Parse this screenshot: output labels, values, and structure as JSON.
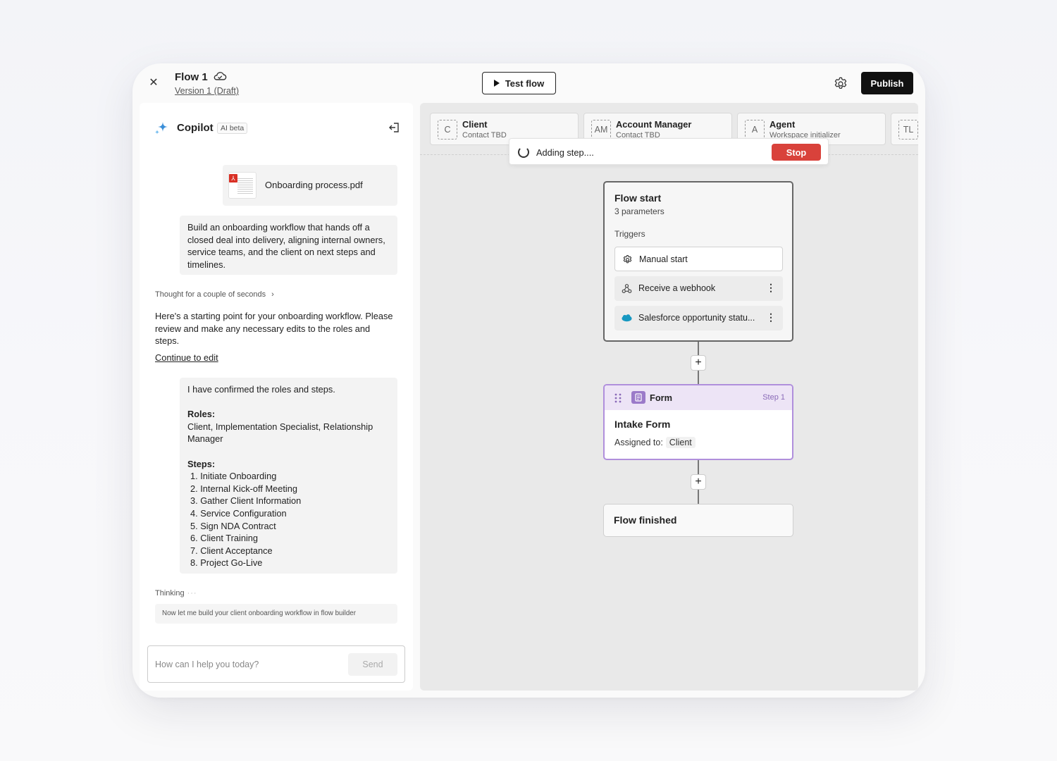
{
  "header": {
    "title": "Flow 1",
    "version": "Version 1 (Draft)",
    "test_label": "Test flow",
    "publish_label": "Publish"
  },
  "copilot": {
    "title": "Copilot",
    "badge": "AI beta",
    "attachment": "Onboarding process.pdf",
    "user_message_1": "Build an onboarding workflow that hands off a closed deal into delivery, aligning internal owners, service teams, and the client on next steps and timelines.",
    "thought": "Thought for a couple of seconds",
    "ai_message": "Here's a starting point for your onboarding workflow. Please review and make any necessary edits to the roles and steps.",
    "continue_link": "Continue to edit",
    "user_message_2": {
      "intro": "I have confirmed the roles and steps.",
      "roles_heading": "Roles:",
      "roles": "Client, Implementation Specialist, Relationship Manager",
      "steps_heading": "Steps:",
      "steps": [
        "1. Initiate Onboarding",
        "2. Internal Kick-off Meeting",
        "3. Gather Client Information",
        "4. Service Configuration",
        "5. Sign NDA Contract",
        "6. Client Training",
        "7. Client Acceptance",
        "8. Project Go-Live"
      ]
    },
    "thinking_label": "Thinking",
    "thinking_dots": "···",
    "thinking_text": "Now let me build your client onboarding workflow in flow builder",
    "input_placeholder": "How can I help you today?",
    "send_label": "Send"
  },
  "canvas": {
    "roles": [
      {
        "abbr": "C",
        "name": "Client",
        "sub": "Contact TBD"
      },
      {
        "abbr": "AM",
        "name": "Account Manager",
        "sub": "Contact TBD"
      },
      {
        "abbr": "A",
        "name": "Agent",
        "sub": "Workspace initializer"
      },
      {
        "abbr": "TL",
        "name": "",
        "sub": ""
      }
    ],
    "adding_text": "Adding step....",
    "stop_label": "Stop",
    "flow_start": {
      "title": "Flow start",
      "params": "3 parameters",
      "triggers_label": "Triggers",
      "triggers": [
        "Manual start",
        "Receive a webhook",
        "Salesforce opportunity statu..."
      ]
    },
    "form_node": {
      "type_label": "Form",
      "step_label": "Step 1",
      "title": "Intake Form",
      "assigned_label": "Assigned to:",
      "assignee": "Client"
    },
    "flow_end": {
      "title": "Flow finished"
    },
    "add_symbol": "+"
  },
  "colors": {
    "stop": "#d9423b",
    "form_border": "#b08fdc",
    "form_header": "#ede4f6",
    "publish_bg": "#111111",
    "salesforce": "#1798c1"
  },
  "icons": [
    "close-icon",
    "cloud-icon",
    "play-icon",
    "gear-icon",
    "sparkle-icon",
    "collapse-panel-icon",
    "pdf-icon",
    "chevron-right-icon",
    "spinner-icon",
    "webhook-icon",
    "salesforce-icon",
    "kebab-icon",
    "drag-handle-icon",
    "form-icon"
  ]
}
